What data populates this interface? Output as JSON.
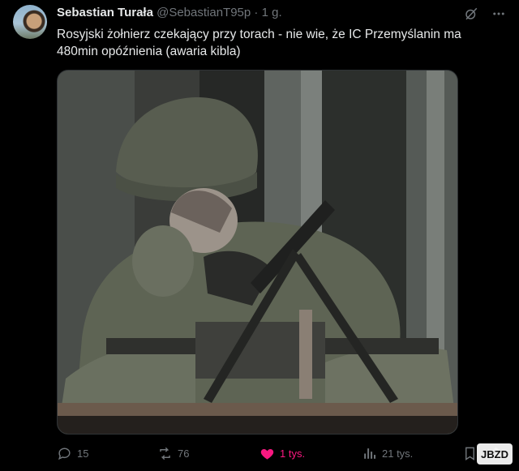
{
  "tweet": {
    "author_name": "Sebastian Turała",
    "handle": "@SebastianT95p",
    "separator": "·",
    "time": "1 g.",
    "text": "Rosyjski żołnierz czekający przy torach - nie wie, że IC Przemyślanin ma 480min opóźnienia (awaria kibla)"
  },
  "icons": {
    "grok": "grok-icon",
    "more": "more-icon"
  },
  "actions": {
    "replies": "15",
    "reposts": "76",
    "likes": "1 tys.",
    "views": "21 tys."
  },
  "colors": {
    "background": "#000000",
    "text": "#e7e9ea",
    "muted": "#71767b",
    "like": "#f91880"
  },
  "watermark": {
    "text": "JBZD"
  }
}
